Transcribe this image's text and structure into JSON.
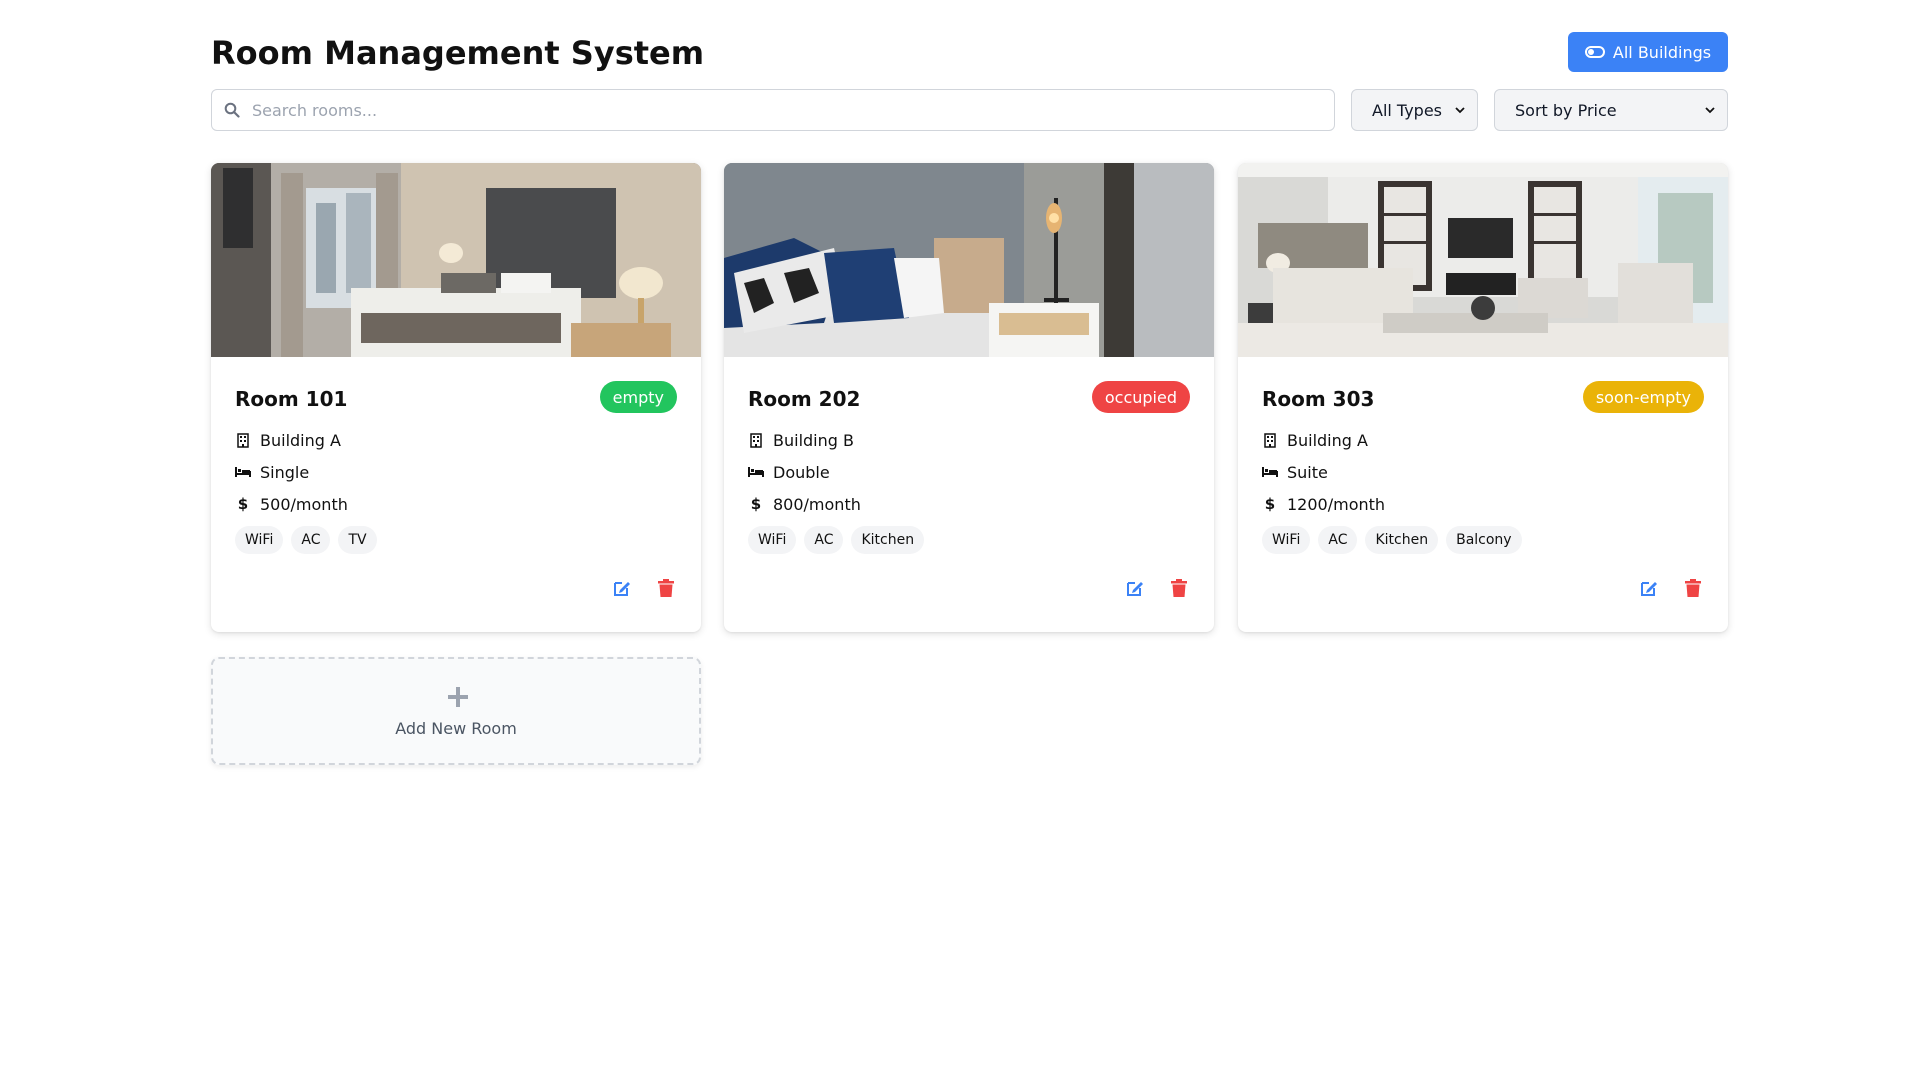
{
  "header": {
    "title": "Room Management System",
    "all_buildings_label": "All Buildings"
  },
  "filters": {
    "search_placeholder": "Search rooms...",
    "search_value": "",
    "type_select": "All Types",
    "sort_select": "Sort by Price"
  },
  "colors": {
    "primary": "#3b82f6",
    "empty": "#22c55e",
    "occupied": "#ef4444",
    "soon_empty": "#eab308",
    "delete": "#ef4444"
  },
  "rooms": [
    {
      "name": "Room 101",
      "status": "empty",
      "building": "Building A",
      "type": "Single",
      "price": "500/month",
      "price_symbol": "$",
      "amenities": [
        "WiFi",
        "AC",
        "TV"
      ],
      "image": "hotel-bedroom-photo"
    },
    {
      "name": "Room 202",
      "status": "occupied",
      "building": "Building B",
      "type": "Double",
      "price": "800/month",
      "price_symbol": "$",
      "amenities": [
        "WiFi",
        "AC",
        "Kitchen"
      ],
      "image": "bed-closeup-photo"
    },
    {
      "name": "Room 303",
      "status": "soon-empty",
      "building": "Building A",
      "type": "Suite",
      "price": "1200/month",
      "price_symbol": "$",
      "amenities": [
        "WiFi",
        "AC",
        "Kitchen",
        "Balcony"
      ],
      "image": "living-room-photo"
    }
  ],
  "add_room": {
    "label": "Add New Room"
  },
  "icons": {
    "search": "search-icon",
    "toggle": "toggle-icon",
    "building": "building-icon",
    "bed": "bed-icon",
    "dollar": "dollar-icon",
    "edit": "edit-icon",
    "delete": "trash-icon",
    "add": "plus-icon"
  }
}
